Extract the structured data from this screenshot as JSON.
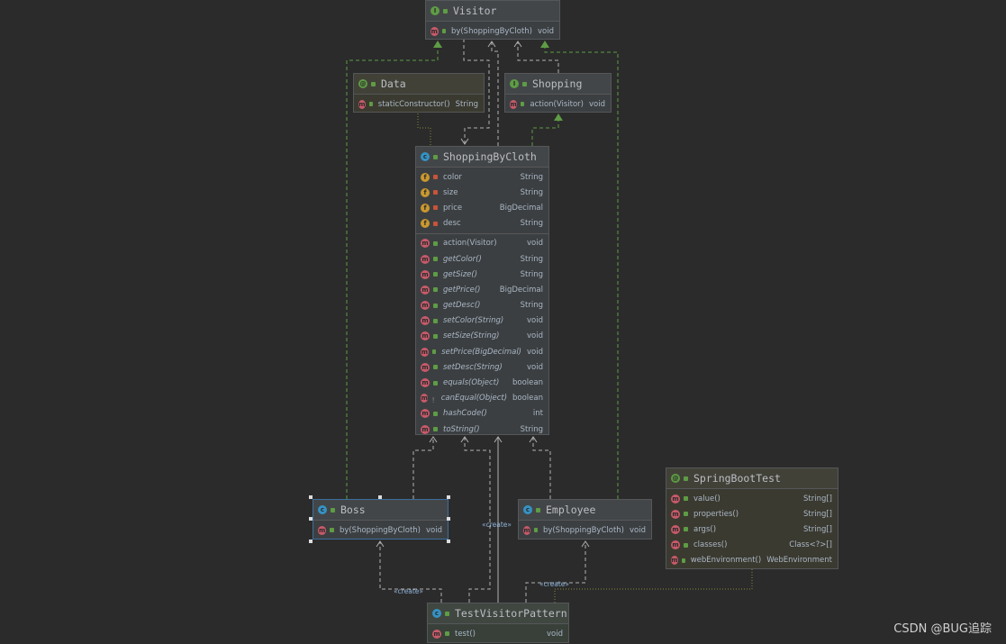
{
  "nodes": {
    "visitor": {
      "title": "Visitor",
      "kind": "interface",
      "members": [
        {
          "name": "by(ShoppingByCloth)",
          "type": "void"
        }
      ]
    },
    "data": {
      "title": "Data",
      "kind": "annotation",
      "members": [
        {
          "name": "staticConstructor()",
          "type": "String"
        }
      ]
    },
    "shopping": {
      "title": "Shopping",
      "kind": "interface",
      "members": [
        {
          "name": "action(Visitor)",
          "type": "void"
        }
      ]
    },
    "shoppingByCloth": {
      "title": "ShoppingByCloth",
      "kind": "class",
      "fields": [
        {
          "name": "color",
          "type": "String"
        },
        {
          "name": "size",
          "type": "String"
        },
        {
          "name": "price",
          "type": "BigDecimal"
        },
        {
          "name": "desc",
          "type": "String"
        }
      ],
      "methods": [
        {
          "name": "action(Visitor)",
          "type": "void"
        },
        {
          "name": "getColor()",
          "type": "String"
        },
        {
          "name": "getSize()",
          "type": "String"
        },
        {
          "name": "getPrice()",
          "type": "BigDecimal"
        },
        {
          "name": "getDesc()",
          "type": "String"
        },
        {
          "name": "setColor(String)",
          "type": "void"
        },
        {
          "name": "setSize(String)",
          "type": "void"
        },
        {
          "name": "setPrice(BigDecimal)",
          "type": "void"
        },
        {
          "name": "setDesc(String)",
          "type": "void"
        },
        {
          "name": "equals(Object)",
          "type": "boolean"
        },
        {
          "name": "canEqual(Object)",
          "type": "boolean"
        },
        {
          "name": "hashCode()",
          "type": "int"
        },
        {
          "name": "toString()",
          "type": "String"
        }
      ]
    },
    "boss": {
      "title": "Boss",
      "kind": "class",
      "members": [
        {
          "name": "by(ShoppingByCloth)",
          "type": "void"
        }
      ]
    },
    "employee": {
      "title": "Employee",
      "kind": "class",
      "members": [
        {
          "name": "by(ShoppingByCloth)",
          "type": "void"
        }
      ]
    },
    "springBootTest": {
      "title": "SpringBootTest",
      "kind": "annotation",
      "members": [
        {
          "name": "value()",
          "type": "String[]"
        },
        {
          "name": "properties()",
          "type": "String[]"
        },
        {
          "name": "args()",
          "type": "String[]"
        },
        {
          "name": "classes()",
          "type": "Class<?>[]"
        },
        {
          "name": "webEnvironment()",
          "type": "WebEnvironment"
        }
      ]
    },
    "testVisitorPattern": {
      "title": "TestVisitorPattern",
      "kind": "class",
      "members": [
        {
          "name": "test()",
          "type": "void"
        }
      ]
    }
  },
  "edge_labels": {
    "create1": "«create»",
    "create2": "«create»",
    "create3": "«create»"
  },
  "watermark": "CSDN @BUG追踪",
  "colors": {
    "background": "#2b2b2b",
    "implements": "#5e9c45",
    "dependency": "#a0a0a0",
    "annotation": "#8a8a3a",
    "selection": "#3d6e9e"
  }
}
